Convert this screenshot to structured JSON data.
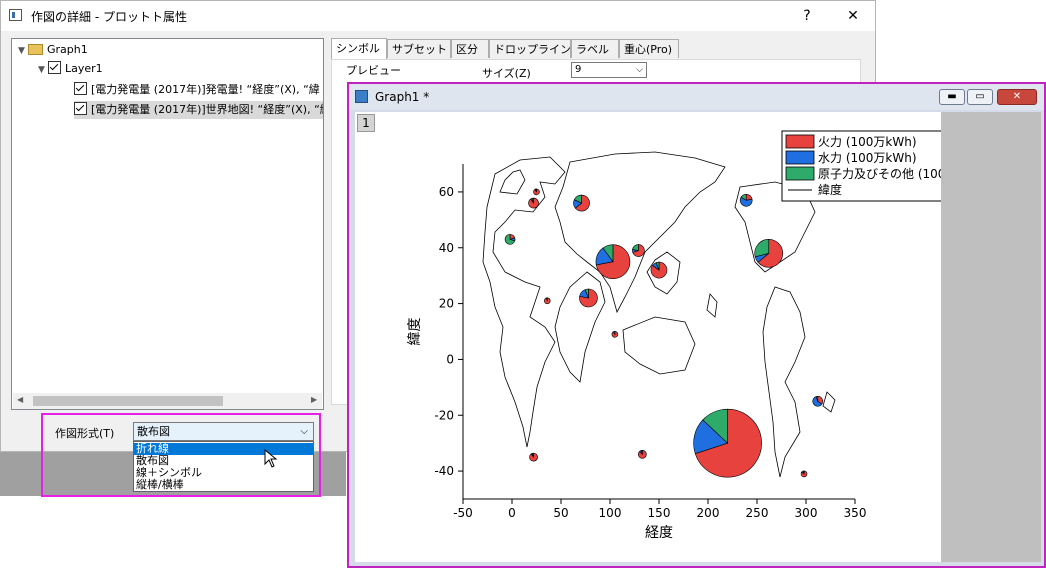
{
  "dialog": {
    "title": "作図の詳細 - プロットト属性",
    "help_label": "?",
    "close_label": "✕",
    "tree": {
      "root": "Graph1",
      "layer": "Layer1",
      "plots": [
        "[電力発電量 (2017年)]発電量! “経度”(X), “緯",
        "[電力発電量 (2017年)]世界地図! “経度”(X), “緯"
      ]
    },
    "tabs": [
      "シンボル",
      "サブセット",
      "区分",
      "ドロップライン",
      "ラベル",
      "重心(Pro)"
    ],
    "preview_label": "プレビュー",
    "size_label": "サイズ(Z)",
    "size_value": "9",
    "plot_type_label": "作図形式(T)",
    "plot_type_value": "散布図",
    "plot_type_options": [
      "折れ線",
      "散布図",
      "線＋シンボル",
      "縦棒/横棒"
    ]
  },
  "graph_window": {
    "title": "Graph1 *",
    "layer_tag": "1",
    "buttons": {
      "minimize": "▬",
      "restore": "▭",
      "close": "✕"
    }
  },
  "chart_data": {
    "type": "scatter",
    "title": "",
    "xlabel": "経度",
    "ylabel": "緯度",
    "xlim": [
      -50,
      350
    ],
    "ylim": [
      -50,
      70
    ],
    "xticks": [
      -50,
      0,
      50,
      100,
      150,
      200,
      250,
      300,
      350
    ],
    "yticks": [
      -40,
      -20,
      0,
      20,
      40,
      60
    ],
    "legend": {
      "placement": "top-right",
      "entries": [
        {
          "name": "火力 (100万kWh)",
          "color": "#e8423f"
        },
        {
          "name": "水力 (100万kWh)",
          "color": "#1f6fe0"
        },
        {
          "name": "原子力及びその他 (100万kWh)",
          "color": "#2eaa6a"
        },
        {
          "name": "緯度",
          "color": "#000000",
          "line": true
        }
      ]
    },
    "colors": {
      "thermal": "#e8423f",
      "hydro": "#1f6fe0",
      "nuclear": "#2eaa6a"
    },
    "pies": [
      {
        "x": 220,
        "y": -30,
        "r": 34,
        "fractions": [
          0.7,
          0.17,
          0.13
        ]
      },
      {
        "x": 103,
        "y": 35,
        "r": 17,
        "fractions": [
          0.72,
          0.18,
          0.1
        ]
      },
      {
        "x": 262,
        "y": 38,
        "r": 14,
        "fractions": [
          0.64,
          0.07,
          0.29
        ]
      },
      {
        "x": 78,
        "y": 22,
        "r": 9,
        "fractions": [
          0.78,
          0.16,
          0.06
        ]
      },
      {
        "x": 71,
        "y": 56,
        "r": 8,
        "fractions": [
          0.64,
          0.18,
          0.18
        ]
      },
      {
        "x": 129,
        "y": 39,
        "r": 6,
        "fractions": [
          0.7,
          0.08,
          0.22
        ]
      },
      {
        "x": 150,
        "y": 32,
        "r": 8,
        "fractions": [
          0.85,
          0.09,
          0.06
        ]
      },
      {
        "x": 239,
        "y": 57,
        "r": 6,
        "fractions": [
          0.22,
          0.62,
          0.16
        ]
      },
      {
        "x": 312,
        "y": -15,
        "r": 5,
        "fractions": [
          0.35,
          0.6,
          0.05
        ]
      },
      {
        "x": 22,
        "y": 56,
        "r": 5,
        "fractions": [
          0.9,
          0.05,
          0.05
        ]
      },
      {
        "x": -2,
        "y": 43,
        "r": 5,
        "fractions": [
          0.2,
          0.1,
          0.7
        ]
      },
      {
        "x": 36,
        "y": 21,
        "r": 3,
        "fractions": [
          0.95,
          0.05,
          0.0
        ]
      },
      {
        "x": 105,
        "y": 9,
        "r": 3,
        "fractions": [
          0.9,
          0.1,
          0.0
        ]
      },
      {
        "x": 22,
        "y": -35,
        "r": 4,
        "fractions": [
          0.9,
          0.05,
          0.05
        ]
      },
      {
        "x": 133,
        "y": -34,
        "r": 4,
        "fractions": [
          0.88,
          0.08,
          0.04
        ]
      },
      {
        "x": 298,
        "y": -41,
        "r": 3,
        "fractions": [
          0.85,
          0.1,
          0.05
        ]
      },
      {
        "x": 25,
        "y": 60,
        "r": 3,
        "fractions": [
          0.9,
          0.05,
          0.05
        ]
      }
    ]
  }
}
